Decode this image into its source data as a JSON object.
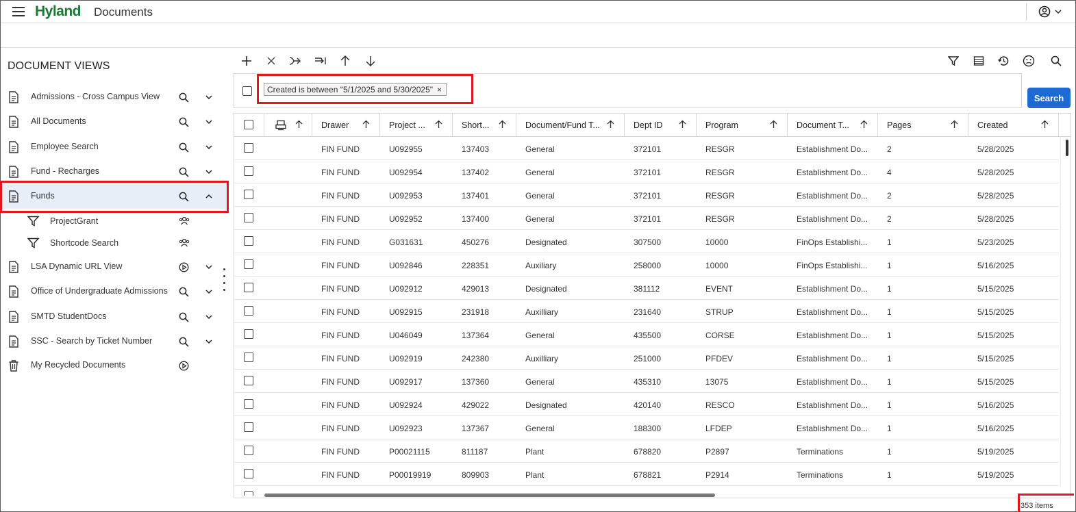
{
  "header": {
    "logo": "Hyland",
    "title": "Documents"
  },
  "sidebar": {
    "title": "DOCUMENT VIEWS",
    "items": [
      {
        "label": "Admissions - Cross Campus View",
        "icon": "document-icon",
        "action": "search-icon",
        "toggle": "chevron-down-icon"
      },
      {
        "label": "All Documents",
        "icon": "document-icon",
        "action": "search-icon",
        "toggle": "chevron-down-icon"
      },
      {
        "label": "Employee Search",
        "icon": "document-icon",
        "action": "search-icon",
        "toggle": "chevron-down-icon"
      },
      {
        "label": "Fund - Recharges",
        "icon": "document-icon",
        "action": "search-icon",
        "toggle": "chevron-down-icon"
      },
      {
        "label": "Funds",
        "icon": "document-icon",
        "action": "search-icon",
        "toggle": "chevron-up-icon",
        "selected": true
      },
      {
        "label": "LSA Dynamic URL View",
        "icon": "document-icon",
        "action": "play-icon",
        "toggle": "chevron-down-icon"
      },
      {
        "label": "Office of Undergraduate Admissions",
        "icon": "document-icon",
        "action": "search-icon",
        "toggle": "chevron-down-icon"
      },
      {
        "label": "SMTD StudentDocs",
        "icon": "document-icon",
        "action": "search-icon",
        "toggle": "chevron-down-icon"
      },
      {
        "label": "SSC - Search by Ticket Number",
        "icon": "document-icon",
        "action": "search-icon",
        "toggle": "chevron-down-icon"
      },
      {
        "label": "My Recycled Documents",
        "icon": "trash-icon",
        "action": "play-icon"
      }
    ],
    "sub_items": [
      {
        "label": "ProjectGrant",
        "icon": "filter-icon",
        "badge": "group-icon"
      },
      {
        "label": "Shortcode Search",
        "icon": "filter-icon",
        "badge": "group-icon"
      }
    ]
  },
  "search": {
    "filter_chip": "Created is between \"5/1/2025 and 5/30/2025\"",
    "chip_close": "×",
    "button_label": "Search"
  },
  "table": {
    "columns": [
      "Drawer",
      "Project ...",
      "Short...",
      "Document/Fund T...",
      "Dept ID",
      "Program",
      "Document T...",
      "Pages",
      "Created"
    ],
    "rows": [
      [
        "FIN FUND",
        "U092955",
        "137403",
        "General",
        "372101",
        "RESGR",
        "Establishment Do...",
        "2",
        "5/28/2025"
      ],
      [
        "FIN FUND",
        "U092954",
        "137402",
        "General",
        "372101",
        "RESGR",
        "Establishment Do...",
        "4",
        "5/28/2025"
      ],
      [
        "FIN FUND",
        "U092953",
        "137401",
        "General",
        "372101",
        "RESGR",
        "Establishment Do...",
        "2",
        "5/28/2025"
      ],
      [
        "FIN FUND",
        "U092952",
        "137400",
        "General",
        "372101",
        "RESGR",
        "Establishment Do...",
        "2",
        "5/28/2025"
      ],
      [
        "FIN FUND",
        "G031631",
        "450276",
        "Designated",
        "307500",
        "10000",
        "FinOps Establishi...",
        "1",
        "5/23/2025"
      ],
      [
        "FIN FUND",
        "U092846",
        "228351",
        "Auxiliary",
        "258000",
        "10000",
        "FinOps Establishi...",
        "1",
        "5/16/2025"
      ],
      [
        "FIN FUND",
        "U092912",
        "429013",
        "Designated",
        "381112",
        "EVENT",
        "Establishment Do...",
        "1",
        "5/15/2025"
      ],
      [
        "FIN FUND",
        "U092915",
        "231918",
        "Auxilliary",
        "231640",
        "STRUP",
        "Establishment Do...",
        "1",
        "5/15/2025"
      ],
      [
        "FIN FUND",
        "U046049",
        "137364",
        "General",
        "435500",
        "CORSE",
        "Establishment Do...",
        "1",
        "5/15/2025"
      ],
      [
        "FIN FUND",
        "U092919",
        "242380",
        "Auxilliary",
        "251000",
        "PFDEV",
        "Establishment Do...",
        "1",
        "5/15/2025"
      ],
      [
        "FIN FUND",
        "U092917",
        "137360",
        "General",
        "435310",
        "13075",
        "Establishment Do...",
        "1",
        "5/15/2025"
      ],
      [
        "FIN FUND",
        "U092924",
        "429022",
        "Designated",
        "420140",
        "RESCO",
        "Establishment Do...",
        "1",
        "5/16/2025"
      ],
      [
        "FIN FUND",
        "U092923",
        "137367",
        "General",
        "188300",
        "LFDEP",
        "Establishment Do...",
        "1",
        "5/16/2025"
      ],
      [
        "FIN FUND",
        "P00021115",
        "811187",
        "Plant",
        "678820",
        "P2897",
        "Terminations",
        "1",
        "5/19/2025"
      ],
      [
        "FIN FUND",
        "P00019919",
        "809903",
        "Plant",
        "678821",
        "P2914",
        "Terminations",
        "1",
        "5/19/2025"
      ]
    ]
  },
  "footer": {
    "count": "353 items"
  },
  "colors": {
    "brand": "#1b7a33",
    "accent": "#1e6ad3",
    "highlight": "#e0181b",
    "selected_row": "#e7eef7"
  }
}
